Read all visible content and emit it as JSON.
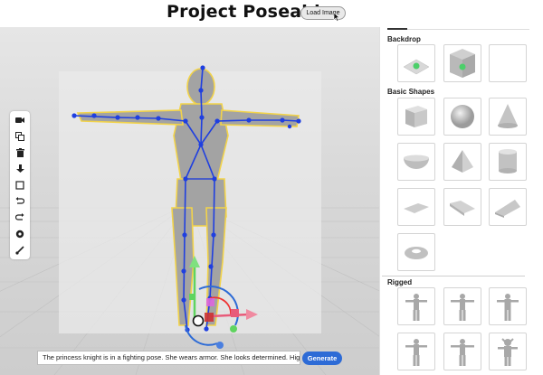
{
  "header": {
    "title": "Project Poseable",
    "load_image_label": "Load Image"
  },
  "toolbar": {
    "tools": [
      {
        "name": "camera-icon"
      },
      {
        "name": "duplicate-icon"
      },
      {
        "name": "trash-icon"
      },
      {
        "name": "download-icon"
      },
      {
        "name": "square-icon"
      },
      {
        "name": "undo-icon"
      },
      {
        "name": "redo-icon"
      },
      {
        "name": "record-icon"
      },
      {
        "name": "brush-icon"
      }
    ]
  },
  "prompt": {
    "value": "The princess knight is in a fighting pose. She wears armor. She looks determined. High quality ...",
    "generate_label": "Generate"
  },
  "panel": {
    "sections": [
      {
        "title": "Backdrop",
        "items": [
          "backdrop-flat",
          "backdrop-corner",
          "backdrop-empty"
        ]
      },
      {
        "title": "Basic Shapes",
        "items": [
          "cube",
          "sphere",
          "cone",
          "bowl",
          "pyramid",
          "cylinder",
          "plane",
          "ramp",
          "wedge",
          "torus"
        ]
      },
      {
        "title": "Rigged",
        "items": [
          "rig-1",
          "rig-2",
          "rig-3",
          "rig-4",
          "rig-5",
          "rig-6"
        ]
      }
    ]
  },
  "colors": {
    "accent": "#2d6bd6",
    "joint": "#1f3fe0",
    "outline": "#f2d34a",
    "model": "#9e9e9e"
  }
}
